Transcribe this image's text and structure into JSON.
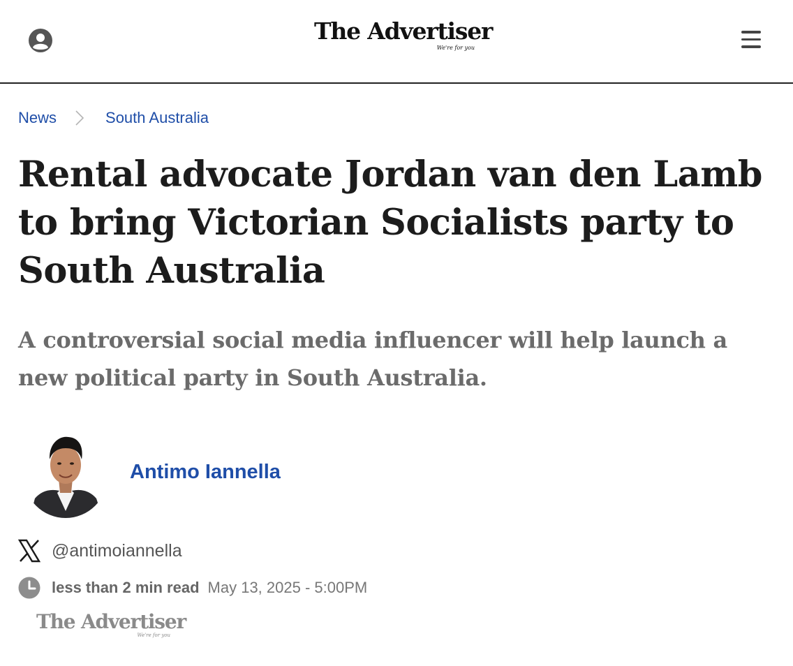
{
  "header": {
    "logo_main": "The Advertiser",
    "logo_tagline": "We're for you",
    "account_icon": "account-circle-icon",
    "menu_icon": "hamburger-menu-icon"
  },
  "breadcrumb": {
    "items": [
      {
        "label": "News"
      },
      {
        "label": "South Australia"
      }
    ],
    "separator_icon": "chevron-right-icon",
    "link_color": "#1f4ea8"
  },
  "article": {
    "headline": "Rental advocate Jordan van den Lamb to bring Victorian Socialists party to South Australia",
    "standfirst": "A controversial social media influencer will help launch a new political party in South Australia.",
    "author": {
      "name": "Antimo Iannella",
      "x_handle": "@antimoiannella",
      "x_icon": "x-logo-icon",
      "photo_icon": "author-photo"
    },
    "read_time": "less than 2 min read",
    "published": "May 13, 2025 - 5:00PM",
    "clock_icon": "clock-icon",
    "source": {
      "logo_main": "The Advertiser",
      "logo_tagline": "We're for you"
    }
  }
}
